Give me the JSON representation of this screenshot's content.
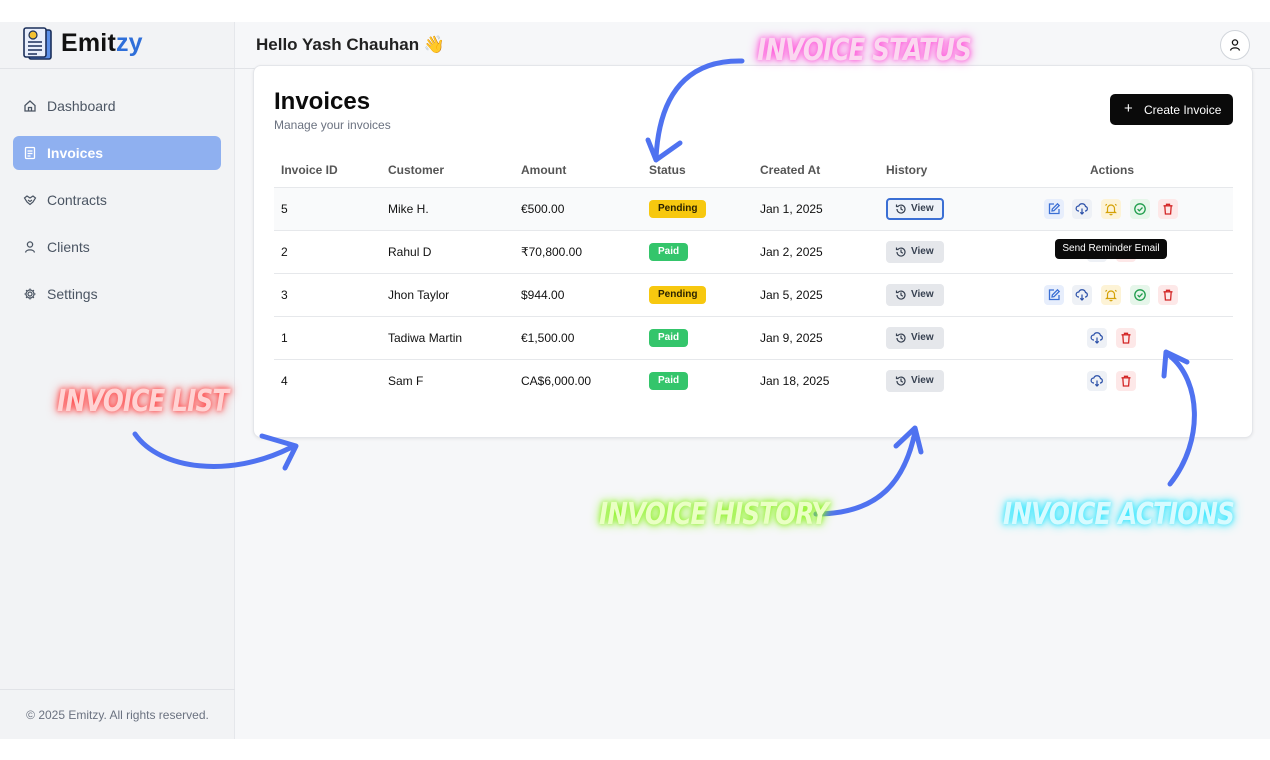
{
  "brand": {
    "name_prefix": "Emit",
    "name_suffix": "zy",
    "accent": "#2f6fd9"
  },
  "sidebar": {
    "items": [
      {
        "label": "Dashboard",
        "icon": "home-icon",
        "active": false
      },
      {
        "label": "Invoices",
        "icon": "document-icon",
        "active": true
      },
      {
        "label": "Contracts",
        "icon": "handshake-icon",
        "active": false
      },
      {
        "label": "Clients",
        "icon": "user-icon",
        "active": false
      },
      {
        "label": "Settings",
        "icon": "gear-icon",
        "active": false
      }
    ],
    "footer": "© 2025 Emitzy. All rights reserved."
  },
  "header": {
    "greeting": "Hello Yash Chauhan 👋",
    "avatar_icon": "user-icon"
  },
  "page": {
    "title": "Invoices",
    "subtitle": "Manage your invoices",
    "create_button": "Create Invoice"
  },
  "table": {
    "headers": [
      "Invoice ID",
      "Customer",
      "Amount",
      "Status",
      "Created At",
      "History",
      "Actions"
    ],
    "view_label": "View",
    "rows": [
      {
        "id": "5",
        "customer": "Mike H.",
        "amount": "€500.00",
        "status": "Pending",
        "created": "Jan 1, 2025"
      },
      {
        "id": "2",
        "customer": "Rahul D",
        "amount": "₹70,800.00",
        "status": "Paid",
        "created": "Jan 2, 2025"
      },
      {
        "id": "3",
        "customer": "Jhon Taylor",
        "amount": "$944.00",
        "status": "Pending",
        "created": "Jan 5, 2025"
      },
      {
        "id": "1",
        "customer": "Tadiwa Martin",
        "amount": "€1,500.00",
        "status": "Paid",
        "created": "Jan 9, 2025"
      },
      {
        "id": "4",
        "customer": "Sam F",
        "amount": "CA$6,000.00",
        "status": "Paid",
        "created": "Jan 18, 2025"
      }
    ],
    "tooltip": "Send Reminder Email"
  },
  "annotations": {
    "status": "INVOICE STATUS",
    "list": "INVOICE LIST",
    "history": "INVOICE HISTORY",
    "actions": "INVOICE ACTIONS"
  },
  "colors": {
    "pending": "#f7c80f",
    "paid": "#34c56b",
    "arrow": "#4f72f0"
  }
}
